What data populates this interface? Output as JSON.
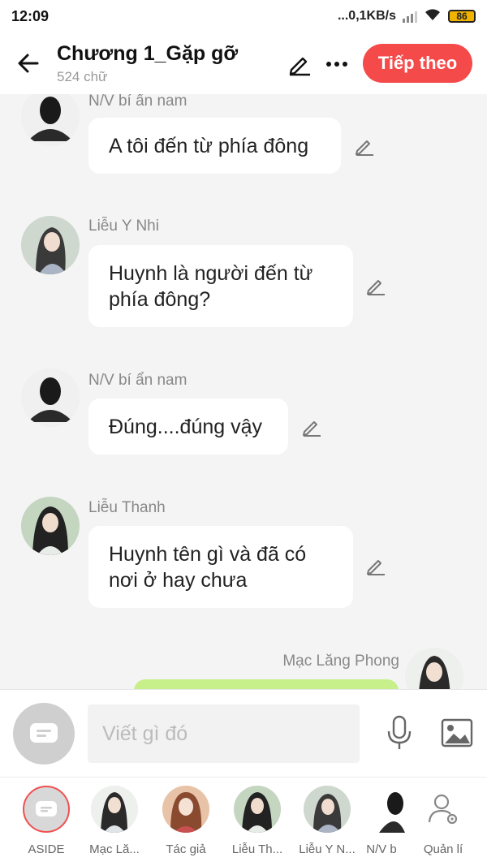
{
  "status_bar": {
    "time": "12:09",
    "network_speed": "...0,1KB/s",
    "battery": "86"
  },
  "header": {
    "title": "Chương 1_Gặp gỡ",
    "subtitle": "524 chữ",
    "next_button": "Tiếp theo"
  },
  "messages": [
    {
      "sender": "N/V bí ẩn nam",
      "text": "A tôi đến từ phía đông",
      "avatar": "silhouette-avatar"
    },
    {
      "sender": "Liễu Y Nhi",
      "text": "Huynh là người đến từ phía đông?",
      "avatar": "female-character-avatar"
    },
    {
      "sender": "N/V bí ẩn nam",
      "text": "Đúng....đúng vậy",
      "avatar": "silhouette-avatar"
    },
    {
      "sender": "Liễu Thanh",
      "text": "Huynh tên gì và đã có nơi ở hay chưa",
      "avatar": "male-character-avatar"
    },
    {
      "sender": "Mạc Lăng Phong",
      "text": "",
      "avatar": "male-character-avatar"
    }
  ],
  "composer": {
    "placeholder": "Viết gì đó"
  },
  "characters": [
    {
      "label": "ASIDE"
    },
    {
      "label": "Mạc Lă..."
    },
    {
      "label": "Tác giả"
    },
    {
      "label": "Liễu Th..."
    },
    {
      "label": "Liễu Y N..."
    },
    {
      "label": "N/V b"
    },
    {
      "label": "Quản lí"
    }
  ],
  "colors": {
    "accent": "#f54a4a",
    "background": "#f4f4f4",
    "outgoing_bubble": "#c8f08a"
  }
}
